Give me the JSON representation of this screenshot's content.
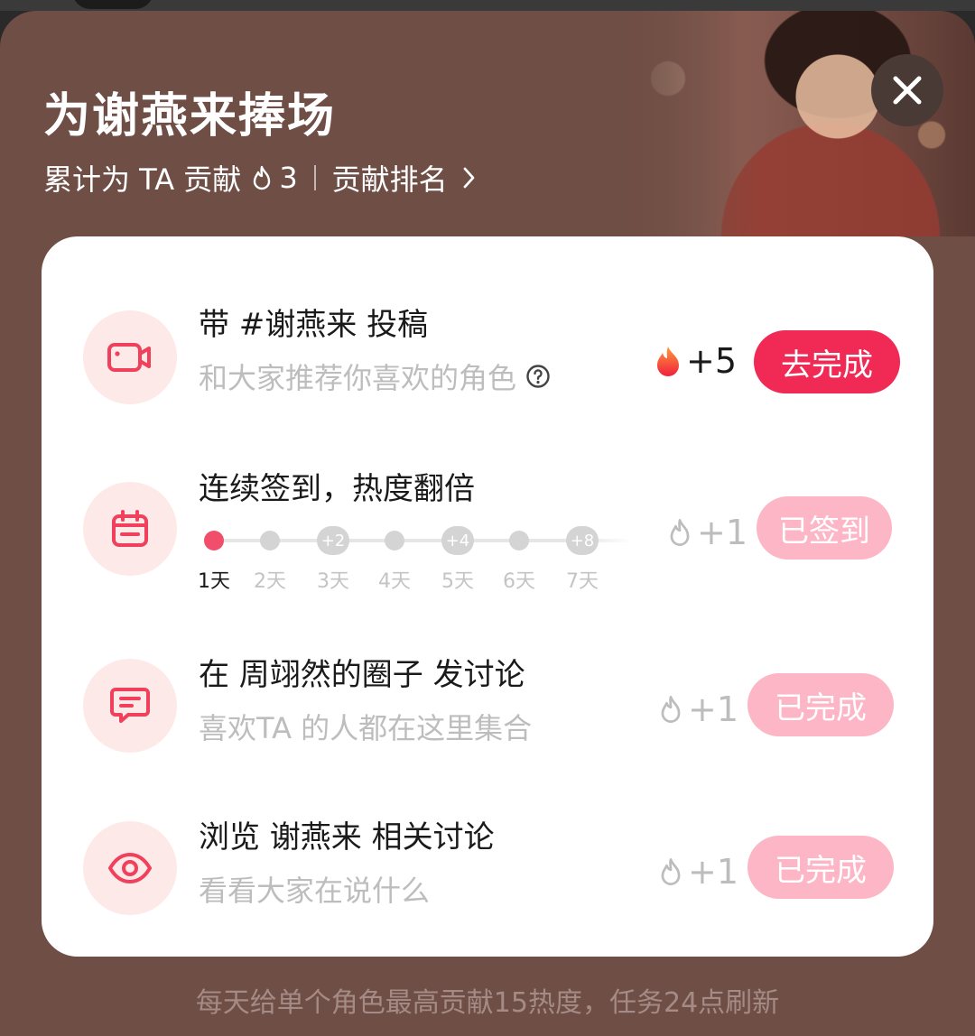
{
  "header": {
    "title": "为谢燕来捧场",
    "contribution_prefix": "累计为 TA 贡献",
    "contribution_value": "3",
    "ranking_link": "贡献排名"
  },
  "tasks": [
    {
      "title": "带 #谢燕来 投稿",
      "desc": "和大家推荐你喜欢的角色",
      "reward": "+5",
      "button": "去完成",
      "icon": "video-camera-icon",
      "state": "todo"
    },
    {
      "title": "连续签到，热度翻倍",
      "reward": "+1",
      "button": "已签到",
      "icon": "calendar-icon",
      "state": "done",
      "streak": {
        "days": [
          "1天",
          "2天",
          "3天",
          "4天",
          "5天",
          "6天",
          "7天"
        ],
        "bonuses": [
          "+2",
          "+4",
          "+8"
        ],
        "current_day": 1
      }
    },
    {
      "title": "在 周翊然的圈子 发讨论",
      "desc": "喜欢TA 的人都在这里集合",
      "reward": "+1",
      "button": "已完成",
      "icon": "chat-bubble-icon",
      "state": "done"
    },
    {
      "title": "浏览 谢燕来 相关讨论",
      "desc": "看看大家在说什么",
      "reward": "+1",
      "button": "已完成",
      "icon": "eye-icon",
      "state": "done"
    }
  ],
  "footer": {
    "note": "每天给单个角色最高贡献15热度，任务24点刷新"
  },
  "colors": {
    "sheet_bg": "#6f4e45",
    "accent": "#f02a54",
    "accent_muted": "#fdb6c6",
    "icon_bg": "#fde9e7",
    "icon_stroke": "#f0405c"
  }
}
